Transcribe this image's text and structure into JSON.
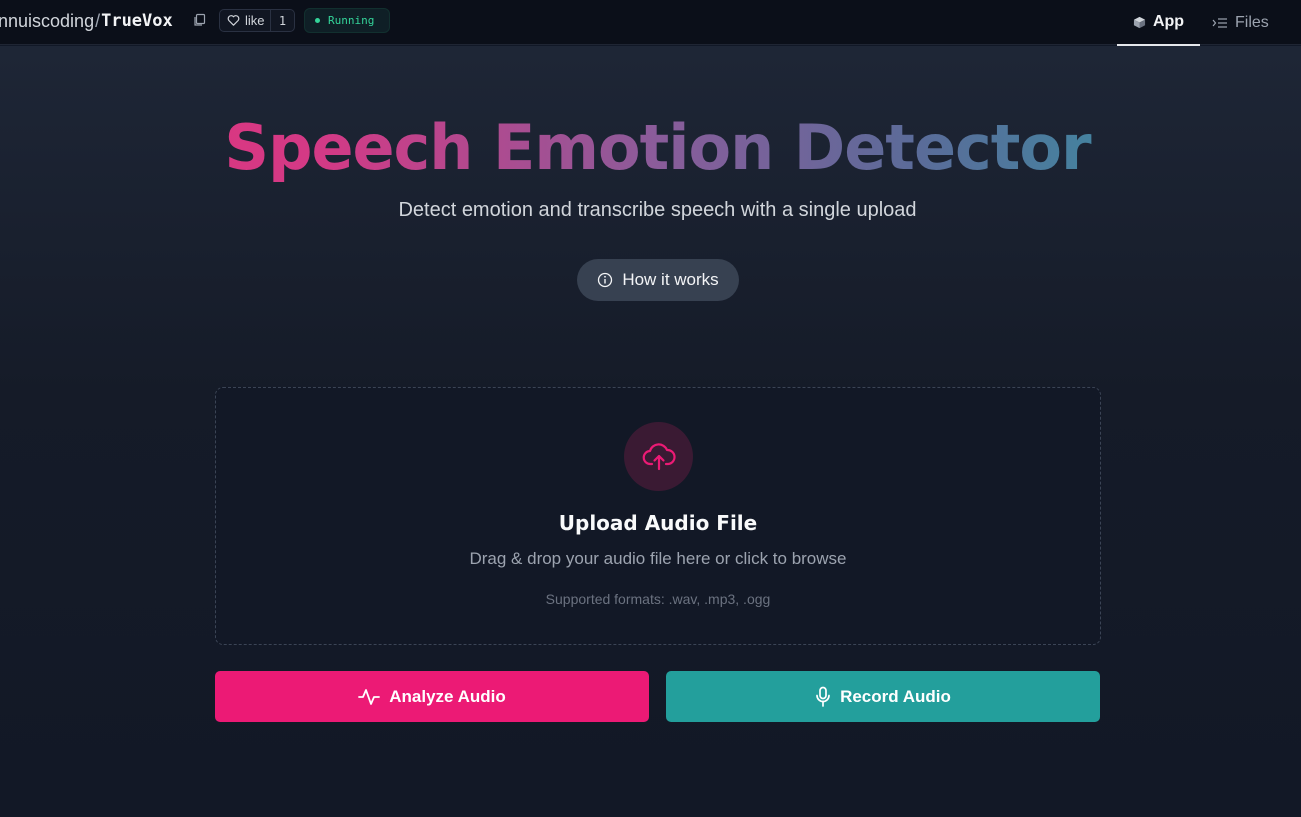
{
  "header": {
    "repo_owner": "nnuiscoding",
    "repo_slash": "/",
    "repo_name": "TrueVox",
    "like_label": "like",
    "like_count": "1",
    "status": "Running",
    "status_color": "#34d399",
    "tabs": [
      {
        "label": "App",
        "icon": "cube-icon",
        "active": true
      },
      {
        "label": "Files",
        "icon": "files-icon",
        "active": false
      }
    ]
  },
  "hero": {
    "title": "Speech Emotion Detector",
    "subtitle": "Detect emotion and transcribe speech with a single upload",
    "how_button": "How it works"
  },
  "upload": {
    "icon": "cloud-upload-icon",
    "title": "Upload Audio File",
    "subtitle": "Drag & drop your audio file here or click to browse",
    "formats": "Supported formats: .wav, .mp3, .ogg"
  },
  "actions": {
    "analyze_label": "Analyze Audio",
    "analyze_color": "#ec1a75",
    "record_label": "Record Audio",
    "record_color": "#239f9c"
  }
}
